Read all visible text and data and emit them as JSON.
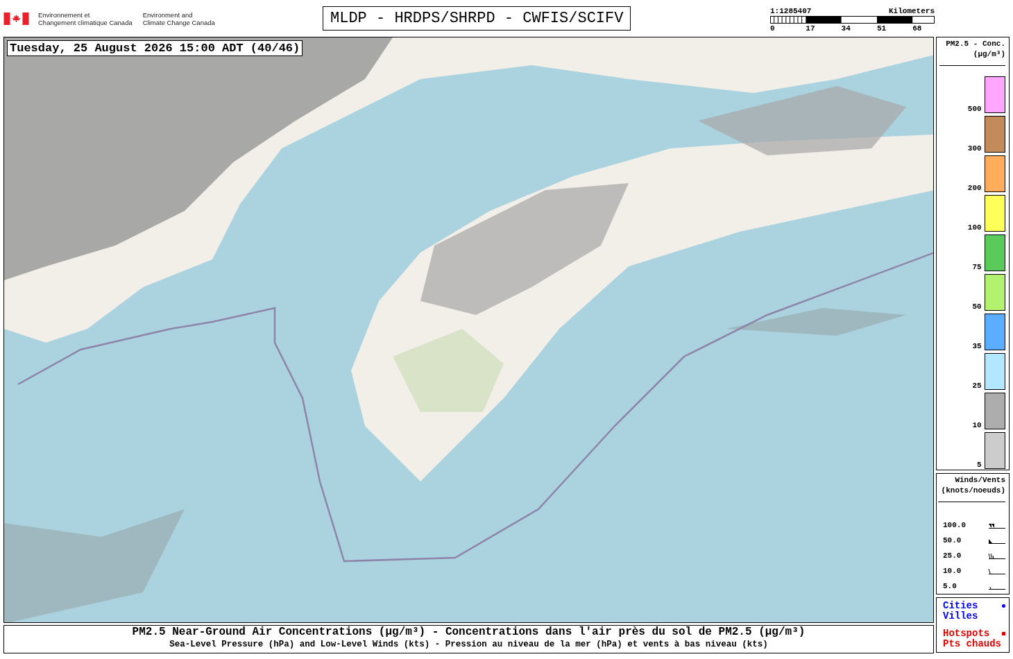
{
  "header": {
    "agency_fr": [
      "Environnement et",
      "Changement climatique Canada"
    ],
    "agency_en": [
      "Environment and",
      "Climate Change Canada"
    ],
    "title": "MLDP - HRDPS/SHRPD - CWFIS/SCIFV",
    "scale": {
      "ratio": "1:1285407",
      "unit": "Kilometers",
      "ticks": [
        "0",
        "17",
        "34",
        "51",
        "68"
      ]
    }
  },
  "map": {
    "kind": "picture",
    "timestamp": "Tuesday, 25 August 2026 15:00 ADT (40/46)"
  },
  "concentration_legend": {
    "title": "PM2.5 - Conc.",
    "unit": "(µg/m³)",
    "bins": [
      {
        "color": "#ffa6ff",
        "label": "500"
      },
      {
        "color": "#c48b5a",
        "label": "300"
      },
      {
        "color": "#ffad5a",
        "label": "200"
      },
      {
        "color": "#ffff5a",
        "label": "100"
      },
      {
        "color": "#5acb5a",
        "label": "75"
      },
      {
        "color": "#b3f26e",
        "label": "50"
      },
      {
        "color": "#5aadff",
        "label": "35"
      },
      {
        "color": "#b3e6ff",
        "label": "25"
      },
      {
        "color": "#adadad",
        "label": "10"
      },
      {
        "color": "#cccccc",
        "label": "5"
      }
    ]
  },
  "wind_legend": {
    "title": "Winds/Vents",
    "unit": "(knots/noeuds)",
    "speeds": [
      {
        "label": "100.0",
        "kind": "doublepennant"
      },
      {
        "label": "50.0",
        "kind": "pennant"
      },
      {
        "label": "25.0",
        "kind": "barbs"
      },
      {
        "label": "10.0",
        "kind": "barb"
      },
      {
        "label": "5.0",
        "kind": "halfbarb"
      }
    ]
  },
  "symbols": [
    {
      "kind": "city",
      "labels": [
        "Cities",
        "Villes"
      ]
    },
    {
      "kind": "hotspot",
      "labels": [
        "Hotspots",
        "Pts chauds"
      ]
    }
  ],
  "caption": [
    "PM2.5 Near-Ground Air Concentrations (µg/m³) - Concentrations dans l'air près du sol de PM2.5 (µg/m³)",
    "Sea-Level Pressure (hPa) and Low-Level Winds (kts) - Pression au niveau de la mer (hPa) et vents à bas niveau (kts)"
  ]
}
